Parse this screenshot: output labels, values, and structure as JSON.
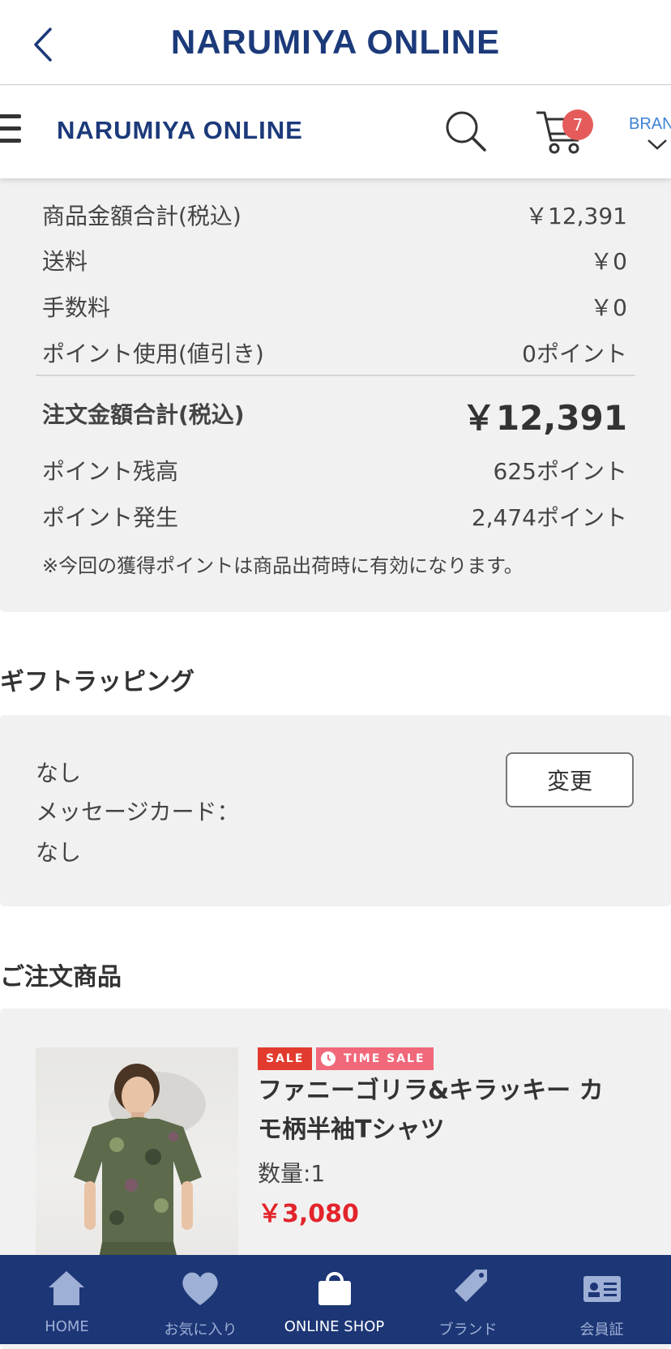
{
  "appbar": {
    "title": "NARUMIYA ONLINE"
  },
  "header": {
    "logo": "NARUMIYA ONLINE",
    "cart_count": "7",
    "brand_label": "BRAN"
  },
  "summary": {
    "rows": [
      {
        "label": "商品金額合計(税込)",
        "value": "￥12,391"
      },
      {
        "label": "送料",
        "value": "￥0"
      },
      {
        "label": "手数料",
        "value": "￥0"
      },
      {
        "label": "ポイント使用(値引き)",
        "value": "0ポイント"
      }
    ],
    "total": {
      "label": "注文金額合計(税込)",
      "value": "￥12,391"
    },
    "points": [
      {
        "label": "ポイント残高",
        "value": "625ポイント"
      },
      {
        "label": "ポイント発生",
        "value": "2,474ポイント"
      }
    ],
    "note": "※今回の獲得ポイントは商品出荷時に有効になります。"
  },
  "gift": {
    "title": "ギフトラッピング",
    "wrapping": "なし",
    "message_label": "メッセージカード：",
    "message_value": "なし",
    "change_button": "変更"
  },
  "order": {
    "title": "ご注文商品",
    "product": {
      "sale_badge": "SALE",
      "time_sale_badge": "TIME SALE",
      "name": "ファニーゴリラ&キラッキー カモ柄半袖Tシャツ",
      "quantity": "数量:1",
      "price": "￥3,080"
    }
  },
  "bottom_nav": [
    {
      "label": "HOME",
      "icon": "home-icon",
      "active": false
    },
    {
      "label": "お気に入り",
      "icon": "heart-icon",
      "active": false
    },
    {
      "label": "ONLINE SHOP",
      "icon": "shopping-bag-icon",
      "active": true
    },
    {
      "label": "ブランド",
      "icon": "tag-icon",
      "active": false
    },
    {
      "label": "会員証",
      "icon": "member-card-icon",
      "active": false
    }
  ]
}
